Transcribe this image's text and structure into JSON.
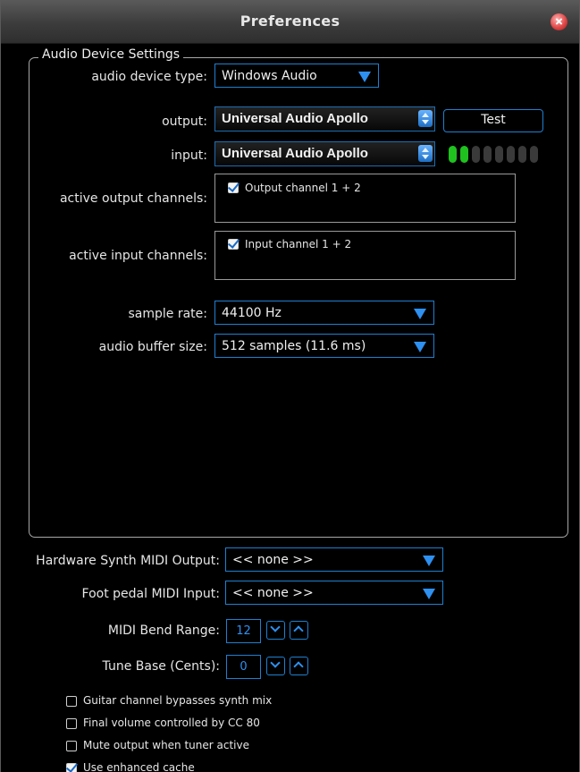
{
  "window": {
    "title": "Preferences"
  },
  "group": {
    "title": "Audio Device Settings"
  },
  "device": {
    "type_label": "audio device type:",
    "type_value": "Windows Audio",
    "output_label": "output:",
    "output_value": "Universal Audio Apollo",
    "input_label": "input:",
    "input_value": "Universal Audio Apollo",
    "test_label": "Test",
    "input_level_leds_lit": 2,
    "input_level_leds_total": 8,
    "led_on_color": "#1fc21f",
    "led_off_color": "#3a3a3a",
    "active_output_label": "active output channels:",
    "output_channels": [
      {
        "label": "Output channel 1 + 2",
        "checked": true
      }
    ],
    "active_input_label": "active input channels:",
    "input_channels": [
      {
        "label": "Input channel 1 + 2",
        "checked": true
      }
    ],
    "sample_rate_label": "sample rate:",
    "sample_rate_value": "44100 Hz",
    "buffer_label": "audio buffer size:",
    "buffer_value": "512 samples (11.6 ms)"
  },
  "midi": {
    "synth_output_label": "Hardware Synth MIDI Output:",
    "synth_output_value": "<< none >>",
    "foot_pedal_label": "Foot pedal MIDI Input:",
    "foot_pedal_value": "<< none >>",
    "bend_range_label": "MIDI Bend Range:",
    "bend_range_value": "12",
    "tune_base_label": "Tune Base (Cents):",
    "tune_base_value": "0"
  },
  "options": [
    {
      "label": "Guitar channel bypasses synth mix",
      "checked": false
    },
    {
      "label": "Final volume controlled by CC 80",
      "checked": false
    },
    {
      "label": "Mute output when tuner active",
      "checked": false
    },
    {
      "label": "Use enhanced cache",
      "checked": true
    }
  ],
  "colors": {
    "accent": "#1f7fd0",
    "arrow": "#2e90f0",
    "background": "#000000"
  }
}
